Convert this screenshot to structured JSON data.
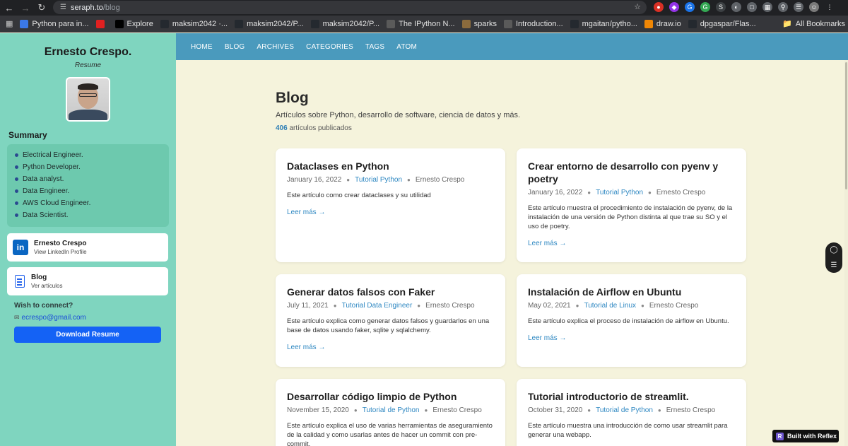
{
  "browser": {
    "url_host": "seraph.to",
    "url_path": "/blog",
    "bookmarks": [
      {
        "label": "Python para in...",
        "icon_color": "#3b78e7"
      },
      {
        "label": "",
        "icon_color": "#e02020"
      },
      {
        "label": "Explore",
        "icon_color": "#000000"
      },
      {
        "label": "maksim2042 ·...",
        "icon_color": "#24292f"
      },
      {
        "label": "maksim2042/P...",
        "icon_color": "#24292f"
      },
      {
        "label": "maksim2042/P...",
        "icon_color": "#24292f"
      },
      {
        "label": "The IPython N...",
        "icon_color": "#5a5a5a"
      },
      {
        "label": "sparks",
        "icon_color": "#8b6b3d"
      },
      {
        "label": "Introduction...",
        "icon_color": "#5a5a5a"
      },
      {
        "label": "mgaitan/pytho...",
        "icon_color": "#24292f"
      },
      {
        "label": "draw.io",
        "icon_color": "#f08705"
      },
      {
        "label": "dpgaspar/Flas...",
        "icon_color": "#24292f"
      }
    ],
    "all_bookmarks": "All Bookmarks"
  },
  "sidebar": {
    "name": "Ernesto Crespo.",
    "subtitle": "Resume",
    "summary_title": "Summary",
    "summary_items": [
      "Electrical Engineer.",
      "Python Developer.",
      "Data analyst.",
      "Data Engineer.",
      "AWS Cloud Engineer.",
      "Data Scientist."
    ],
    "linkedin": {
      "title": "Ernesto Crespo",
      "sub": "View LinkedIn Profile"
    },
    "blog": {
      "title": "Blog",
      "sub": "Ver artículos"
    },
    "wish": "Wish to connect?",
    "email": "ecrespo@gmail.com",
    "download": "Download Resume"
  },
  "nav": [
    "HOME",
    "BLOG",
    "ARCHIVES",
    "CATEGORIES",
    "TAGS",
    "ATOM"
  ],
  "main": {
    "title": "Blog",
    "description": "Artículos sobre Python, desarrollo de software, ciencia de datos y más.",
    "count": "406",
    "count_label": "artículos publicados",
    "read_more": "Leer más →"
  },
  "posts": [
    {
      "title": "Dataclases en Python",
      "date": "January 16, 2022",
      "category": "Tutorial Python",
      "author": "Ernesto Crespo",
      "excerpt": "Este artículo como crear dataclases y su utilidad"
    },
    {
      "title": "Crear entorno de desarrollo con pyenv y poetry",
      "date": "January 16, 2022",
      "category": "Tutorial Python",
      "author": "Ernesto Crespo",
      "excerpt": "Este artículo muestra el procedimiento de instalación de pyenv, de la instalación de una versión de Python distinta al que trae su SO y el uso de poetry."
    },
    {
      "title": "Generar datos falsos con Faker",
      "date": "July 11, 2021",
      "category": "Tutorial Data Engineer",
      "author": "Ernesto Crespo",
      "excerpt": "Este artículo explica como generar datos falsos y guardarlos en una base de datos usando faker, sqlite y sqlalchemy."
    },
    {
      "title": "Instalación de Airflow en Ubuntu",
      "date": "May 02, 2021",
      "category": "Tutorial de Linux",
      "author": "Ernesto Crespo",
      "excerpt": "Este artículo explica el proceso de instalación de airflow en Ubuntu."
    },
    {
      "title": "Desarrollar código limpio de Python",
      "date": "November 15, 2020",
      "category": "Tutorial de Python",
      "author": "Ernesto Crespo",
      "excerpt": "Este artículo explica el uso de varias herramientas de aseguramiento de la calidad y como usarlas antes de hacer un commit con pre-commit."
    },
    {
      "title": "Tutorial introductorio de streamlit.",
      "date": "October 31, 2020",
      "category": "Tutorial de Python",
      "author": "Ernesto Crespo",
      "excerpt": "Este artículo muestra una introducción de como usar streamlit para generar una webapp."
    }
  ],
  "widgets": {
    "reflex": "Built with Reflex"
  }
}
